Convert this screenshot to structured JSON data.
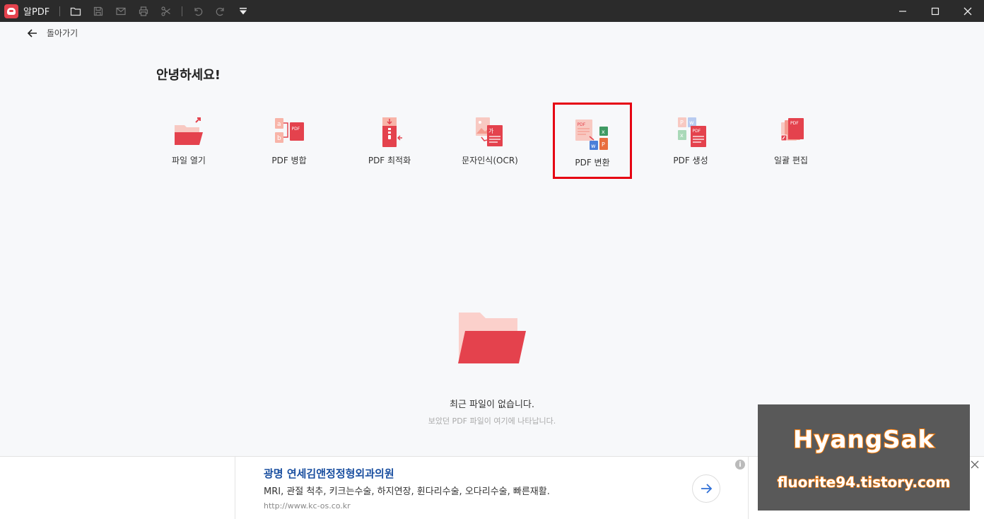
{
  "app": {
    "title": "알PDF"
  },
  "toolbar": {
    "icons": [
      "folder-icon",
      "save-icon",
      "mail-icon",
      "print-icon",
      "scissors-icon",
      "undo-icon",
      "redo-icon",
      "dropdown-icon"
    ]
  },
  "nav": {
    "back_label": "돌아가기"
  },
  "greeting": "안녕하세요!",
  "actions": [
    {
      "label": "파일 열기",
      "icon": "open-folder-icon"
    },
    {
      "label": "PDF 병합",
      "icon": "merge-icon"
    },
    {
      "label": "PDF 최적화",
      "icon": "compress-icon"
    },
    {
      "label": "문자인식(OCR)",
      "icon": "ocr-icon"
    },
    {
      "label": "PDF 변환",
      "icon": "convert-icon",
      "selected": true
    },
    {
      "label": "PDF 생성",
      "icon": "create-icon"
    },
    {
      "label": "일괄 편집",
      "icon": "batch-edit-icon"
    }
  ],
  "empty": {
    "title": "최근 파일이 없습니다.",
    "subtitle": "보았던 PDF 파일이 여기에 나타납니다."
  },
  "ad": {
    "title": "광명 연세김앤정정형외과의원",
    "description": "MRI, 관절 척추, 키크는수술, 하지연장, 휜다리수술, 오다리수술, 빠른재활.",
    "url": "http://www.kc-os.co.kr",
    "info": "i"
  },
  "watermark": {
    "name": "HyangSak",
    "url": "fluorite94.tistory.com"
  },
  "colors": {
    "accent": "#e4424d",
    "highlight": "#e60012",
    "titlebar": "#2b2b2b",
    "ad_title": "#1a4fa0"
  }
}
